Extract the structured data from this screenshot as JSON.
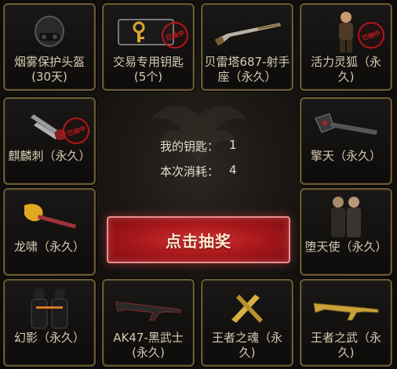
{
  "prizes": [
    {
      "name": "烟雾保护头盔\n(30天)",
      "icon": "helmet-icon",
      "stamp": false
    },
    {
      "name": "交易专用钥匙\n(5个)",
      "icon": "key-icon",
      "stamp": true
    },
    {
      "name": "贝雷塔687-射手\n座（永久）",
      "icon": "shotgun-icon",
      "stamp": false
    },
    {
      "name": "活力灵狐（永\n久)",
      "icon": "character-icon",
      "stamp": true
    },
    {
      "name": "麒麟刺（永久）",
      "icon": "claw-weapon-icon",
      "stamp": true
    },
    {
      "name": "擎天（永久）",
      "icon": "hammer-icon",
      "stamp": false
    },
    {
      "name": "龙啸（永久）",
      "icon": "dragon-axe-icon",
      "stamp": false
    },
    {
      "name": "堕天使（永久）",
      "icon": "character-pair-icon",
      "stamp": false
    },
    {
      "name": "幻影（永久）",
      "icon": "soldiers-icon",
      "stamp": false
    },
    {
      "name": "AK47-黑武士\n(永久)",
      "icon": "rifle-icon",
      "stamp": false
    },
    {
      "name": "王者之魂（永\n久)",
      "icon": "golden-blade-icon",
      "stamp": false
    },
    {
      "name": "王者之武（永\n久)",
      "icon": "golden-rifle-icon",
      "stamp": false
    }
  ],
  "stamp_text": "已抽中",
  "stats": {
    "keys_label": "我的钥匙：",
    "keys_value": "1",
    "cost_label": "本次消耗：",
    "cost_value": "4"
  },
  "draw_button_label": "点击抽奖",
  "colors": {
    "tile_border": "#6b5a34",
    "button_red": "#c0191f",
    "label_text": "#d6cbb2"
  }
}
